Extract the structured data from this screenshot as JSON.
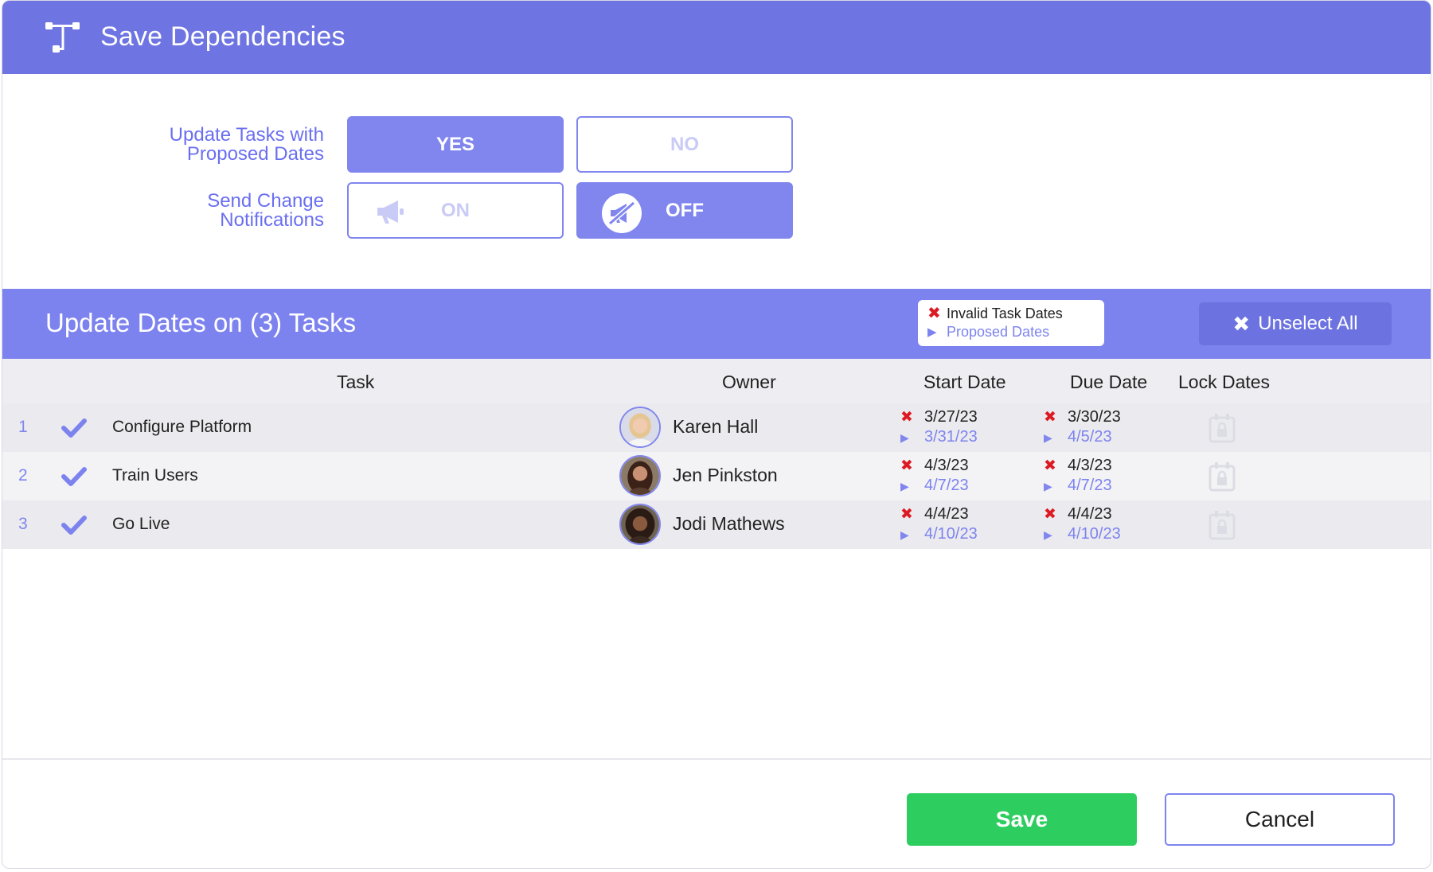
{
  "header": {
    "title": "Save Dependencies",
    "icon": "dependencies-icon"
  },
  "options": {
    "update_tasks": {
      "label_line1": "Update Tasks with",
      "label_line2": "Proposed Dates",
      "yes_label": "YES",
      "no_label": "NO",
      "selected": "YES"
    },
    "notifications": {
      "label_line1": "Send Change",
      "label_line2": "Notifications",
      "on_label": "ON",
      "off_label": "OFF",
      "selected": "OFF"
    }
  },
  "section": {
    "title": "Update Dates on (3) Tasks",
    "legend": {
      "invalid_label": "Invalid Task Dates",
      "proposed_label": "Proposed Dates"
    },
    "unselect_label": "Unselect All"
  },
  "table": {
    "columns": {
      "task": "Task",
      "owner": "Owner",
      "start": "Start Date",
      "due": "Due Date",
      "lock": "Lock Dates"
    },
    "rows": [
      {
        "num": "1",
        "task": "Configure Platform",
        "owner": "Karen Hall",
        "start_old": "3/27/23",
        "start_new": "3/31/23",
        "due_old": "3/30/23",
        "due_new": "4/5/23",
        "checked": true
      },
      {
        "num": "2",
        "task": "Train Users",
        "owner": "Jen Pinkston",
        "start_old": "4/3/23",
        "start_new": "4/7/23",
        "due_old": "4/3/23",
        "due_new": "4/7/23",
        "checked": true
      },
      {
        "num": "3",
        "task": "Go Live",
        "owner": "Jodi Mathews",
        "start_old": "4/4/23",
        "start_new": "4/10/23",
        "due_old": "4/4/23",
        "due_new": "4/10/23",
        "checked": true
      }
    ]
  },
  "footer": {
    "save_label": "Save",
    "cancel_label": "Cancel"
  },
  "colors": {
    "header": "#6e74e2",
    "accent": "#8086ee",
    "save": "#2ecd5f",
    "invalid": "#dd1a22"
  }
}
